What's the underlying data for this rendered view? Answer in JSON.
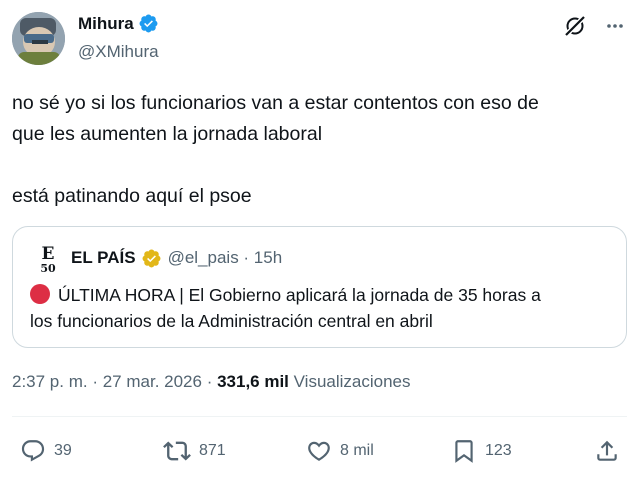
{
  "author": {
    "name": "Mihura",
    "handle": "@XMihura",
    "verified_icon": "verified-badge-icon"
  },
  "top_icons": [
    "grok-icon",
    "more-icon"
  ],
  "tweet": {
    "lines": [
      "no sé yo si los funcionarios van a estar contentos con eso de",
      "que les aumenten la jornada laboral",
      "está patinando aquí el psoe"
    ]
  },
  "quote": {
    "name": "EL PAÍS",
    "handle_time": "@el_pais · 15h",
    "logo_text": "E",
    "logo_subtext": "50",
    "body_line1": "ÚLTIMA HORA | El Gobierno aplicará la jornada de 35 horas a",
    "body_line2": "los funcionarios de la Administración central en abril"
  },
  "meta": {
    "time": "2:37 p. m.",
    "separator": " · ",
    "date": "27 mar. 2026",
    "views_count": "331,6 mil",
    "views_label": "Visualizaciones"
  },
  "actions": {
    "replies": "39",
    "retweets": "871",
    "likes": "8 mil",
    "bookmarks": "123"
  },
  "colors": {
    "text": "#0f1419",
    "secondary": "#536471",
    "verified_blue": "#1d9bf0",
    "gold": "#e2b719",
    "border": "#cfd9de"
  }
}
